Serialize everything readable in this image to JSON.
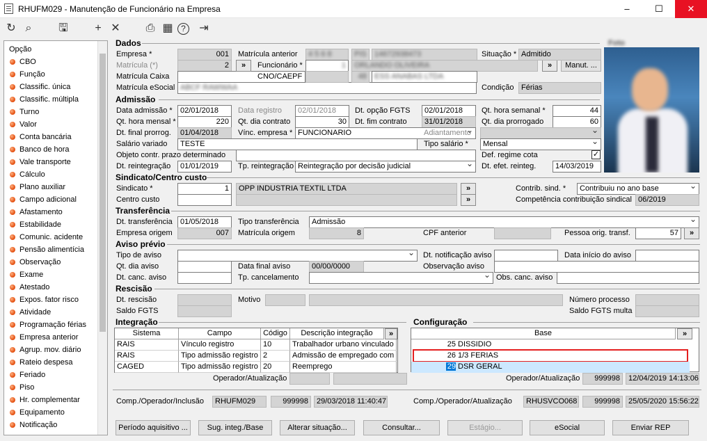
{
  "window": {
    "title": "RHUFM029 - Manutenção de Funcionário na Empresa",
    "min": "–",
    "max": "☐",
    "close": "✕"
  },
  "toolbar": {
    "refresh": "↻",
    "search": "⌕",
    "save": "🖫",
    "add": "+",
    "delete": "✕",
    "print": "⎙",
    "calendar": "▦",
    "help": "?",
    "exit": "⇥"
  },
  "sidebar": {
    "title": "Opção",
    "items": [
      "CBO",
      "Função",
      "Classific. única",
      "Classific. múltipla",
      "Turno",
      "Valor",
      "Conta bancária",
      "Banco de hora",
      "Vale transporte",
      "Cálculo",
      "Plano auxiliar",
      "Campo adicional",
      "Afastamento",
      "Estabilidade",
      "Comunic. acidente",
      "Pensão alimentícia",
      "Observação",
      "Exame",
      "Atestado",
      "Expos. fator risco",
      "Atividade",
      "Programação férias",
      "Empresa anterior",
      "Agrup. mov. diário",
      "Rateio despesa",
      "Feriado",
      "Piso",
      "Hr. complementar",
      "Equipamento",
      "Notificação"
    ]
  },
  "dados": {
    "section": "Dados",
    "empresa_lbl": "Empresa *",
    "empresa": "001",
    "matricula_lbl": "Matrícula (*)",
    "matricula": "2",
    "matricula_caixa_lbl": "Matrícula Caixa",
    "matricula_esocial_lbl": "Matrícula eSocial",
    "matricula_esocial": "ABCF RAWWAA",
    "mat_ant_lbl": "Matrícula anterior",
    "mat_ant": "4 5 6 8",
    "funcionario_lbl": "Funcionário *",
    "funcionario_code": "1",
    "funcionario_name": "ORLANDO OLIVEIRA",
    "pis_lbl": "PIS",
    "pis": "14672938473",
    "cno_lbl": "CNO/CAEPF",
    "cno": "48",
    "cno_name": "ESS ANABAS LTDA",
    "situacao_lbl": "Situação *",
    "situacao": "Admitido",
    "manut": "Manut. ...",
    "condicao_lbl": "Condição",
    "condicao": "Férias",
    "foto_lbl": "Foto",
    "arrow": "»"
  },
  "admissao": {
    "section": "Admissão",
    "dt_adm_lbl": "Data admissão *",
    "dt_adm": "02/01/2018",
    "dt_reg_lbl": "Data registro",
    "dt_reg": "02/01/2018",
    "dt_fgts_lbl": "Dt. opção FGTS",
    "dt_fgts": "02/01/2018",
    "qt_sem_lbl": "Qt. hora semanal *",
    "qt_sem": "44",
    "qt_mens_lbl": "Qt. hora mensal *",
    "qt_mens": "220",
    "qt_dia_lbl": "Qt. dia contrato",
    "qt_dia": "30",
    "dt_fim_lbl": "Dt. fim contrato",
    "dt_fim": "31/01/2018",
    "qt_prorr_lbl": "Qt. dia prorrogado",
    "qt_prorr": "60",
    "dt_final_lbl": "Dt. final prorrog.",
    "dt_final": "01/04/2018",
    "vinc_lbl": "Vínc. empresa *",
    "vinc": "FUNCIONARIO",
    "adiant_lbl": "Adiantamento",
    "sal_var_lbl": "Salário variado",
    "sal_var": "TESTE",
    "tipo_sal_lbl": "Tipo salário *",
    "tipo_sal": "Mensal",
    "obj_lbl": "Objeto contr. prazo determinado",
    "def_lbl": "Def. regime cota",
    "def_check": "✓",
    "dt_reint_lbl": "Dt. reintegração",
    "dt_reint": "01/01/2019",
    "tp_reint_lbl": "Tp. reintegração",
    "tp_reint": "Reintegração por decisão judicial",
    "dt_efet_lbl": "Dt. efet. reinteg.",
    "dt_efet": "14/03/2019"
  },
  "sindicato": {
    "section": "Sindicato/Centro custo",
    "sind_lbl": "Sindicato *",
    "sind_code": "1",
    "sind_name": "OPP INDUSTRIA TEXTIL LTDA",
    "cc_lbl": "Centro custo",
    "contrib_lbl": "Contrib. sind. *",
    "contrib": "Contribuiu no ano base",
    "comp_lbl": "Competência contribuição sindical",
    "comp": "06/2019"
  },
  "transferencia": {
    "section": "Transferência",
    "dt_lbl": "Dt. transferência",
    "dt": "01/05/2018",
    "tipo_lbl": "Tipo transferência",
    "tipo": "Admissão",
    "emp_lbl": "Empresa origem",
    "emp": "007",
    "mat_lbl": "Matrícula origem",
    "mat": "8",
    "cpf_lbl": "CPF anterior",
    "pessoa_lbl": "Pessoa orig. transf.",
    "pessoa": "57"
  },
  "aviso": {
    "section": "Aviso prévio",
    "tipo_lbl": "Tipo de aviso",
    "dt_not_lbl": "Dt. notificação aviso",
    "dt_ini_lbl": "Data início do aviso",
    "qt_dia_lbl": "Qt. dia aviso",
    "dt_final_lbl": "Data final aviso",
    "dt_final": "00/00/0000",
    "obs_lbl": "Observação aviso",
    "dt_canc_lbl": "Dt. canc. aviso",
    "tp_canc_lbl": "Tp. cancelamento",
    "obs_canc_lbl": "Obs. canc. aviso"
  },
  "rescisao": {
    "section": "Rescisão",
    "dt_lbl": "Dt. rescisão",
    "motivo_lbl": "Motivo",
    "num_lbl": "Número processo",
    "saldo_lbl": "Saldo FGTS",
    "saldo_multa_lbl": "Saldo FGTS multa"
  },
  "integracao": {
    "section": "Integração",
    "cols": [
      "Sistema",
      "Campo",
      "Código",
      "Descrição integração"
    ],
    "rows": [
      [
        "RAIS",
        "Vínculo registro",
        "10",
        "Trabalhador urbano vinculado a"
      ],
      [
        "RAIS",
        "Tipo admissão registro",
        "2",
        "Admissão de empregado com e"
      ],
      [
        "CAGED",
        "Tipo admissão registro",
        "20",
        "Reemprego"
      ]
    ],
    "op_lbl": "Operador/Atualização"
  },
  "configuracao": {
    "section": "Configuração",
    "col": "Base",
    "rows": [
      [
        "25",
        "DISSIDIO"
      ],
      [
        "26",
        "1/3 FERIAS"
      ],
      [
        "29",
        "DSR GERAL"
      ]
    ],
    "op_lbl": "Operador/Atualização",
    "op": "999998",
    "dt": "12/04/2019 14:13:06"
  },
  "footer": {
    "inc_lbl": "Comp./Operador/Inclusão",
    "inc_comp": "RHUFM029",
    "inc_op": "999998",
    "inc_dt": "29/03/2018 11:40:47",
    "atu_lbl": "Comp./Operador/Atualização",
    "atu_comp": "RHUSVCO068",
    "atu_op": "999998",
    "atu_dt": "25/05/2020 15:56:22"
  },
  "buttons": [
    "Período aquisitivo ...",
    "Sug. integ./Base",
    "Alterar situação...",
    "Consultar...",
    "Estágio...",
    "eSocial",
    "Enviar REP"
  ]
}
